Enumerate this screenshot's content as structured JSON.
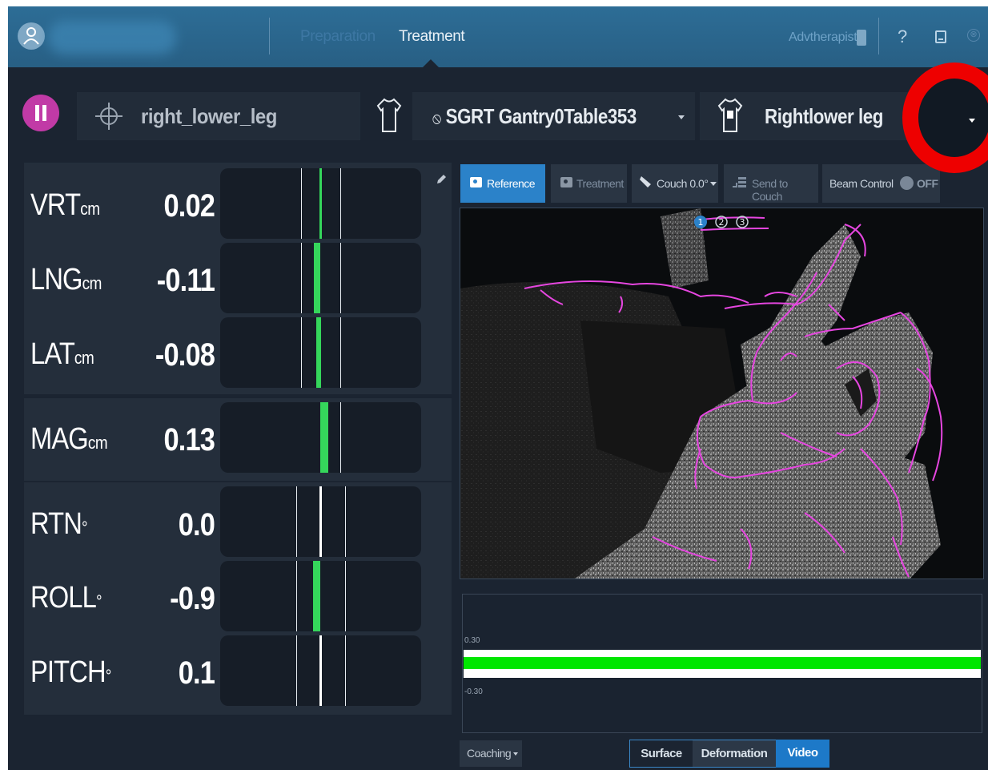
{
  "header": {
    "tabs": [
      {
        "label": "Preparation",
        "active": false
      },
      {
        "label": "Treatment",
        "active": true
      }
    ],
    "user_label": "Advtherapist",
    "help_label": "?",
    "close_glyph": "⊗",
    "colors": {
      "bar": "#2a6890",
      "active_tab": "#e9f1f7",
      "inactive_tab": "#3d77a3"
    }
  },
  "selectors": {
    "roi": "right_lower_leg",
    "gantry_table": "SGRT Gantry0Table353",
    "gantry_prefix_icon": "⦸",
    "body_part": "Rightlower leg"
  },
  "metrics": [
    {
      "name": "VRT",
      "unit": "cm",
      "value": "0.02"
    },
    {
      "name": "LNG",
      "unit": "cm",
      "value": "-0.11"
    },
    {
      "name": "LAT",
      "unit": "cm",
      "value": "-0.08"
    },
    {
      "name": "MAG",
      "unit": "cm",
      "value": "0.13"
    },
    {
      "name": "RTN",
      "unit": "°",
      "value": "0.0"
    },
    {
      "name": "ROLL",
      "unit": "°",
      "value": "-0.9"
    },
    {
      "name": "PITCH",
      "unit": "°",
      "value": "0.1"
    }
  ],
  "video_toolbar": {
    "reference": "Reference",
    "treatment": "Treatment",
    "couch": "Couch 0.0°",
    "send_to_couch": "Send to Couch",
    "beam_control": "Beam Control",
    "beam_state": "OFF"
  },
  "video": {
    "camera_tabs": [
      "1",
      "2",
      "3"
    ],
    "active_camera": "1",
    "overlay_color": "#e646e0"
  },
  "graph": {
    "upper_label": "0.30",
    "lower_label": "-0.30",
    "trace_color": "#00e600"
  },
  "bottom": {
    "coaching": "Coaching",
    "views": [
      {
        "label": "Surface",
        "active": false
      },
      {
        "label": "Deformation",
        "active": false
      },
      {
        "label": "Video",
        "active": true
      }
    ]
  },
  "icons": [
    "user-icon",
    "pause-icon",
    "crosshair-icon",
    "torso-icon",
    "body-part-icon",
    "edit-icon",
    "camera-icon",
    "couch-icon",
    "send-to-couch-icon",
    "help-icon",
    "minimize-icon",
    "close-icon",
    "dropdown-arrow-icon"
  ],
  "colors": {
    "accent": "#2b82c9",
    "pause_button": "#c13aa6",
    "bar_fill": "#35d65b",
    "annotation_circle": "#ee0000"
  }
}
